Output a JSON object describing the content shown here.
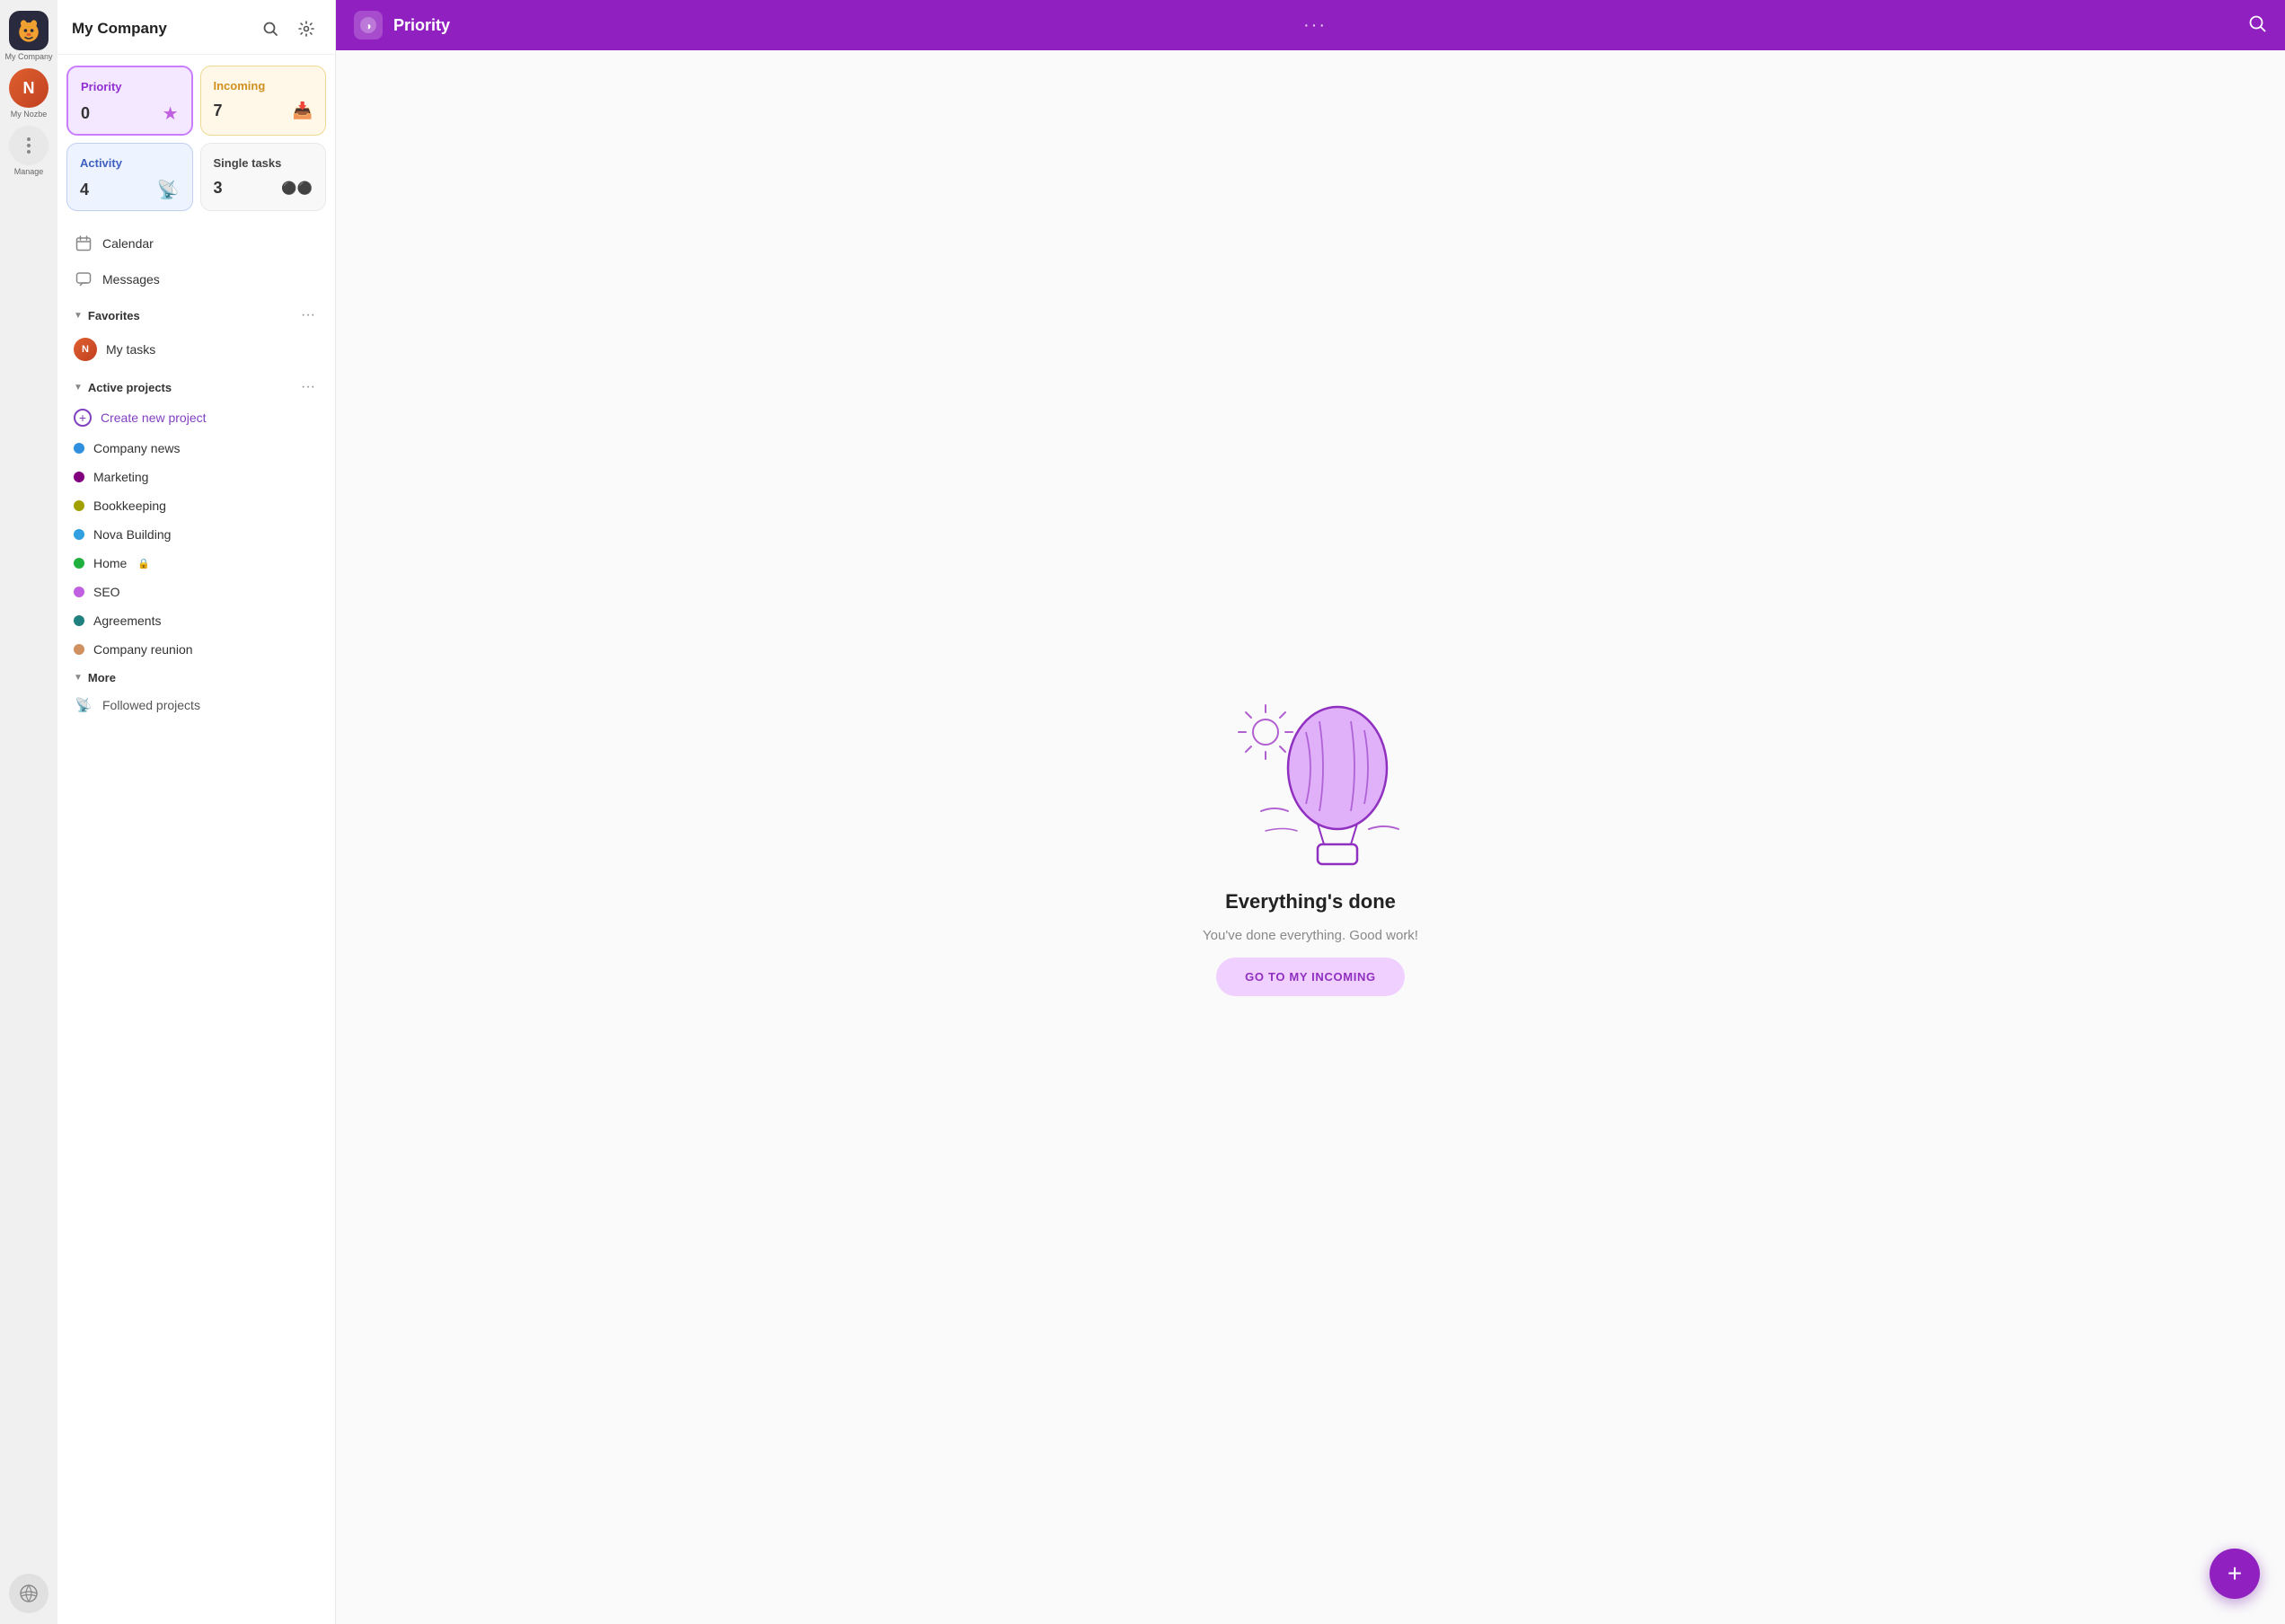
{
  "app": {
    "name": "My Company",
    "logo_bg": "#2a2a3e"
  },
  "rail": {
    "app_label": "My Company",
    "user_label": "My Nozbe",
    "manage_label": "Manage"
  },
  "sidebar": {
    "title": "My Company",
    "search_tooltip": "Search",
    "settings_tooltip": "Settings",
    "tiles": [
      {
        "id": "priority",
        "label": "Priority",
        "count": "0",
        "icon": "★"
      },
      {
        "id": "incoming",
        "label": "Incoming",
        "count": "7",
        "icon": "📥"
      },
      {
        "id": "activity",
        "label": "Activity",
        "count": "4",
        "icon": "📡"
      },
      {
        "id": "single",
        "label": "Single tasks",
        "count": "3",
        "icon": "⚫"
      }
    ],
    "nav": [
      {
        "id": "calendar",
        "label": "Calendar",
        "icon": "📅"
      },
      {
        "id": "messages",
        "label": "Messages",
        "icon": "💬"
      }
    ],
    "favorites": {
      "label": "Favorites",
      "more_label": "···",
      "items": [
        {
          "id": "my-tasks",
          "label": "My tasks"
        }
      ]
    },
    "active_projects": {
      "label": "Active projects",
      "more_label": "···",
      "create_label": "Create new project",
      "items": [
        {
          "id": "company-news",
          "label": "Company news",
          "color": "#3090e0"
        },
        {
          "id": "marketing",
          "label": "Marketing",
          "color": "#800080"
        },
        {
          "id": "bookkeeping",
          "label": "Bookkeeping",
          "color": "#a0a000"
        },
        {
          "id": "nova-building",
          "label": "Nova Building",
          "color": "#30a0e0"
        },
        {
          "id": "home",
          "label": "Home",
          "color": "#20b040",
          "lock": true
        },
        {
          "id": "seo",
          "label": "SEO",
          "color": "#c060e0"
        },
        {
          "id": "agreements",
          "label": "Agreements",
          "color": "#208080"
        },
        {
          "id": "company-reunion",
          "label": "Company reunion",
          "color": "#d09060"
        }
      ]
    },
    "more": {
      "label": "More",
      "items": [
        {
          "id": "followed-projects",
          "label": "Followed projects"
        }
      ]
    }
  },
  "topbar": {
    "title": "Priority",
    "ellipsis": "···"
  },
  "main": {
    "empty_title": "Everything's done",
    "empty_sub": "You've done everything. Good work!",
    "cta_label": "GO TO MY INCOMING"
  },
  "fab": {
    "label": "+"
  }
}
